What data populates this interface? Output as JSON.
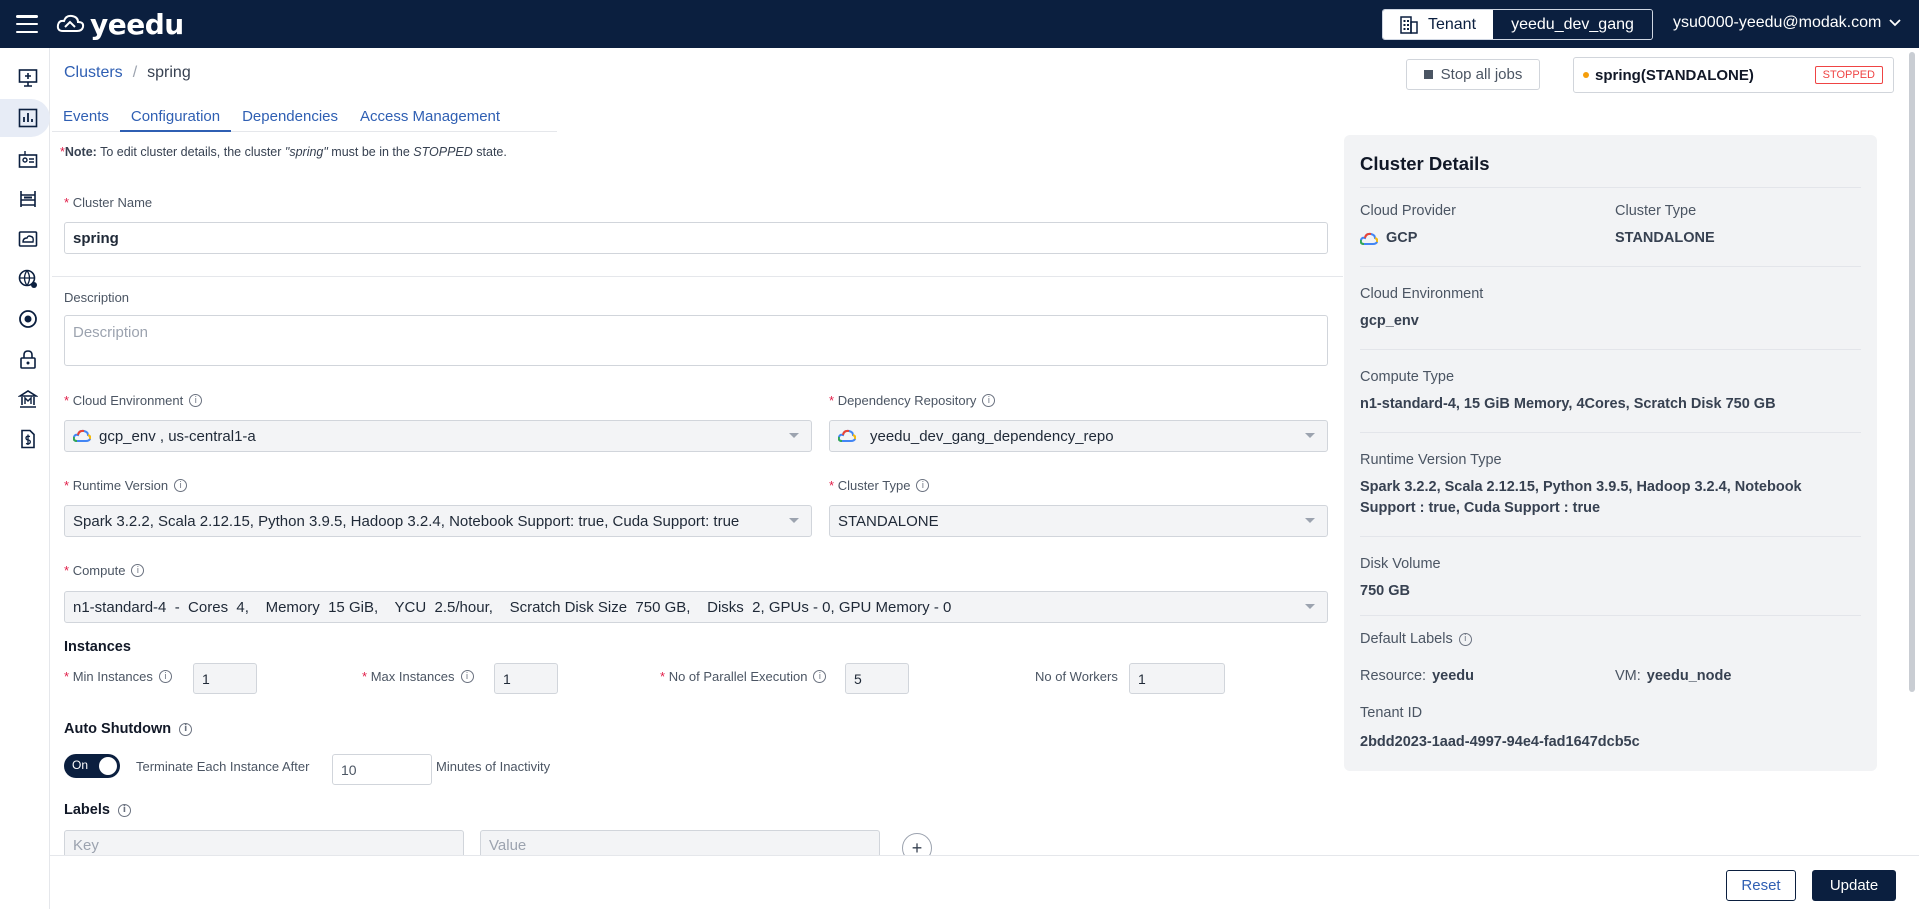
{
  "app": {
    "logo_text": "yeedu"
  },
  "topbar": {
    "tenant_label": "Tenant",
    "tenant_name": "yeedu_dev_gang",
    "user_email": "ysu0000-yeedu@modak.com"
  },
  "breadcrumb": {
    "root": "Clusters",
    "separator": "/",
    "current": "spring"
  },
  "actions": {
    "stop_all_jobs": "Stop all jobs"
  },
  "status": {
    "cluster": "spring(STANDALONE)",
    "state": "STOPPED"
  },
  "tabs": [
    "Events",
    "Configuration",
    "Dependencies",
    "Access Management"
  ],
  "note": {
    "asterisk": "*",
    "label": "Note:",
    "text_1": " To edit cluster details, the cluster ",
    "cluster": "\"spring\"",
    "text_2": " must be in the ",
    "state": "STOPPED",
    "text_3": " state."
  },
  "form": {
    "required_mark": "*",
    "cluster_name": {
      "label": "Cluster Name",
      "value": "spring"
    },
    "description": {
      "label": "Description",
      "placeholder": "Description"
    },
    "cloud_environment": {
      "label": "Cloud Environment",
      "value": "gcp_env , us-central1-a"
    },
    "dependency_repository": {
      "label": "Dependency Repository",
      "value": "yeedu_dev_gang_dependency_repo"
    },
    "runtime_version": {
      "label": "Runtime Version",
      "value": "Spark 3.2.2, Scala 2.12.15, Python 3.9.5, Hadoop 3.2.4, Notebook Support: true, Cuda Support: true"
    },
    "cluster_type": {
      "label": "Cluster Type",
      "value": "STANDALONE"
    },
    "compute": {
      "label": "Compute",
      "value": "n1-standard-4  -  Cores  4,    Memory  15 GiB,    YCU  2.5/hour,    Scratch Disk Size  750 GB,    Disks  2, GPUs - 0, GPU Memory - 0"
    },
    "instances": {
      "title": "Instances",
      "min_label": "Min Instances",
      "min_value": "1",
      "max_label": "Max Instances",
      "max_value": "1",
      "parallel_label": "No of Parallel Execution",
      "parallel_value": "5",
      "workers_label": "No of Workers",
      "workers_value": "1"
    },
    "auto_shutdown": {
      "title": "Auto Shutdown",
      "toggle": "On",
      "prefix": "Terminate Each Instance After",
      "value": "10",
      "suffix": "Minutes of Inactivity"
    },
    "labels": {
      "title": "Labels",
      "key_placeholder": "Key",
      "value_placeholder": "Value",
      "add": "+"
    }
  },
  "details": {
    "title": "Cluster Details",
    "cloud_provider": {
      "label": "Cloud Provider",
      "value": "GCP"
    },
    "cluster_type": {
      "label": "Cluster Type",
      "value": "STANDALONE"
    },
    "cloud_environment": {
      "label": "Cloud Environment",
      "value": "gcp_env"
    },
    "compute_type": {
      "label": "Compute Type",
      "value": "n1-standard-4, 15 GiB Memory, 4Cores, Scratch Disk 750 GB"
    },
    "runtime_version_type": {
      "label": "Runtime Version Type",
      "value_line1": "Spark 3.2.2, Scala 2.12.15, Python 3.9.5, Hadoop 3.2.4, Notebook",
      "value_line2": "Support : true, Cuda Support : true"
    },
    "disk_volume": {
      "label": "Disk Volume",
      "value": "750 GB"
    },
    "default_labels": {
      "label": "Default Labels",
      "resource_key": "Resource:",
      "resource_value": "yeedu",
      "vm_key": "VM:",
      "vm_value": "yeedu_node"
    },
    "tenant_id": {
      "label": "Tenant ID",
      "value": "2bdd2023-1aad-4997-94e4-fad1647dcb5c"
    }
  },
  "footer": {
    "reset": "Reset",
    "update": "Update"
  },
  "colors": {
    "navy": "#0b1f3f",
    "link": "#2f5fb3",
    "stopped": "#ef4444",
    "status_dot": "#f59e0b"
  },
  "icons": [
    "menu-icon",
    "cloud-logo-icon",
    "building-icon",
    "chevron-down-icon",
    "info-icon",
    "gcp-icon",
    "plus-icon"
  ]
}
